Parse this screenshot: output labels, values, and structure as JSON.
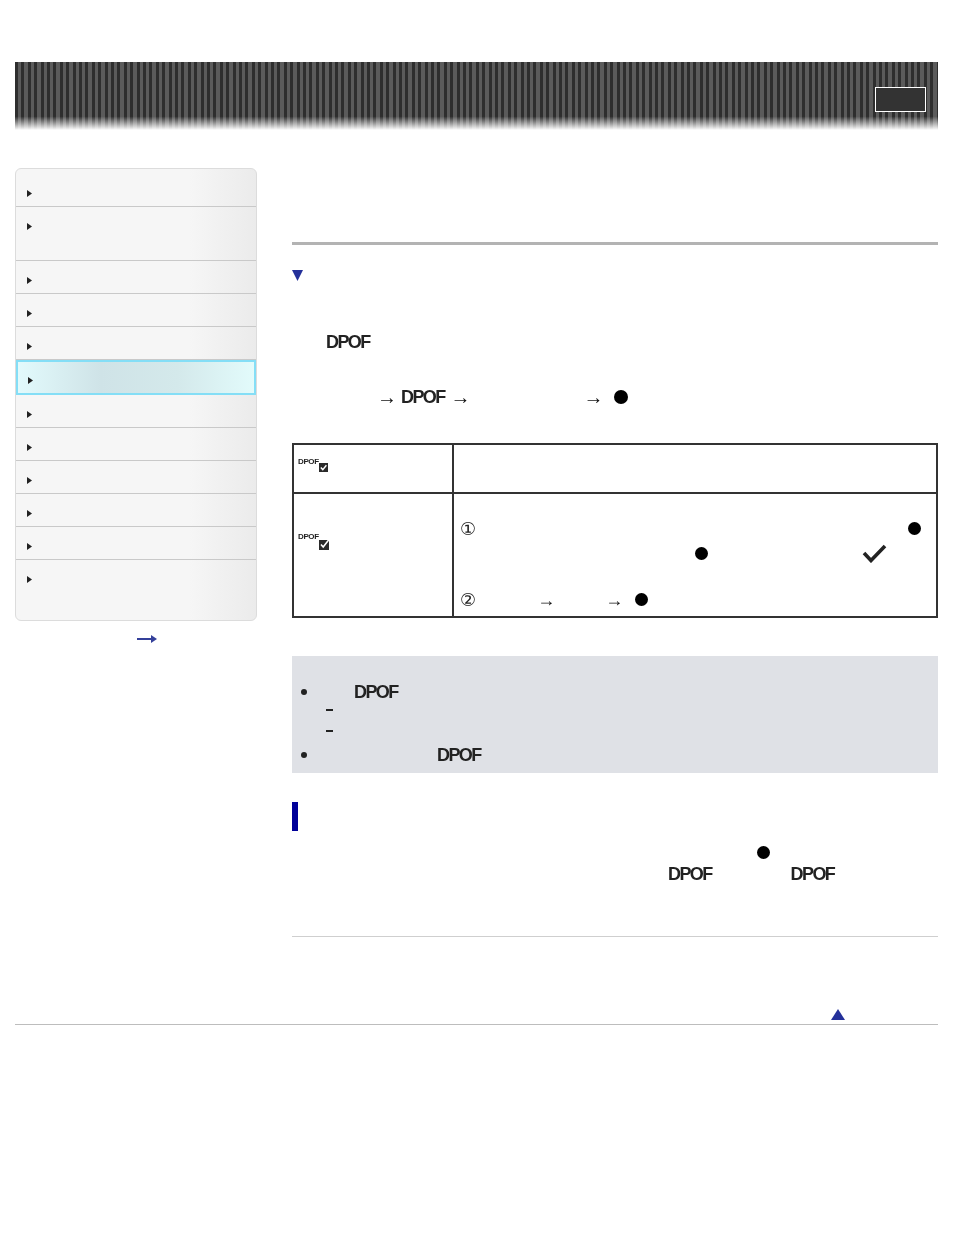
{
  "sidebar": {
    "items": [
      {
        "kind": "single",
        "selected": false
      },
      {
        "kind": "double",
        "selected": false
      },
      {
        "kind": "single",
        "selected": false
      },
      {
        "kind": "single",
        "selected": false
      },
      {
        "kind": "single",
        "selected": false
      },
      {
        "kind": "single",
        "selected": true
      },
      {
        "kind": "single",
        "selected": false
      },
      {
        "kind": "single",
        "selected": false
      },
      {
        "kind": "single",
        "selected": false
      },
      {
        "kind": "single",
        "selected": false
      },
      {
        "kind": "single",
        "selected": false
      },
      {
        "kind": "double",
        "selected": false
      }
    ]
  },
  "intro": {
    "label": "DPOF"
  },
  "menu_path": {
    "arrow_1": "→",
    "label": "DPOF",
    "arrow_2": "→",
    "arrow_3": "→"
  },
  "table": {
    "rows": [
      {
        "icon_label": "DPOF"
      },
      {
        "icon_label": "DPOF",
        "step_1": "①",
        "step_2": "②",
        "step_2_arrow_1": "→",
        "step_2_arrow_2": "→"
      }
    ]
  },
  "note": {
    "labels": [
      "DPOF",
      "DPOF"
    ]
  },
  "tip": {
    "labels": [
      "DPOF",
      "DPOF"
    ]
  }
}
